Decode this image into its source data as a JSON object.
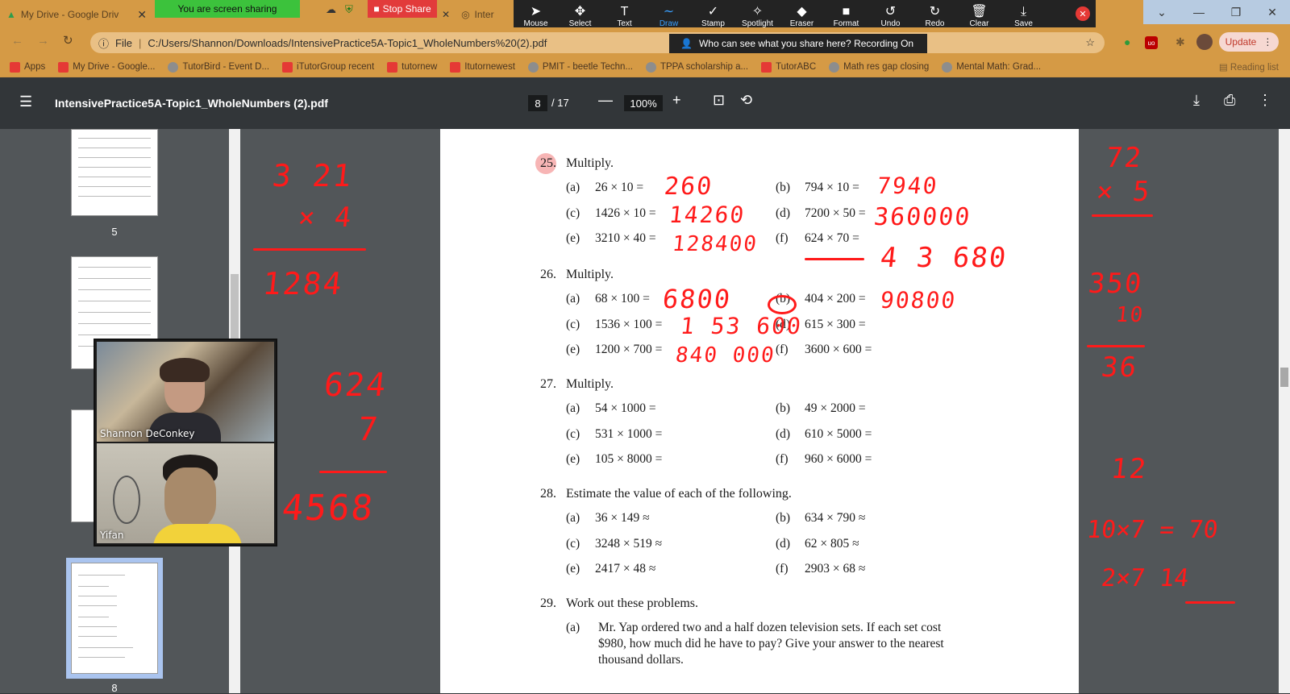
{
  "tabs": [
    {
      "title": "My Drive - Google Driv",
      "icon": "google-drive-icon"
    },
    {
      "title": "",
      "icon": "zoom-icon"
    },
    {
      "title": "Inter",
      "icon": "globe-icon"
    }
  ],
  "share": {
    "status": "You are screen sharing",
    "stop_label": "Stop Share"
  },
  "zoom_toolbar": [
    {
      "label": "Mouse",
      "icon": "pointer-icon",
      "glyph": "➤"
    },
    {
      "label": "Select",
      "icon": "move-icon",
      "glyph": "✥"
    },
    {
      "label": "Text",
      "icon": "text-icon",
      "glyph": "T"
    },
    {
      "label": "Draw",
      "icon": "draw-icon",
      "glyph": "∼"
    },
    {
      "label": "Stamp",
      "icon": "stamp-icon",
      "glyph": "✓"
    },
    {
      "label": "Spotlight",
      "icon": "spotlight-icon",
      "glyph": "✧"
    },
    {
      "label": "Eraser",
      "icon": "eraser-icon",
      "glyph": "◆"
    },
    {
      "label": "Format",
      "icon": "format-icon",
      "glyph": "■"
    },
    {
      "label": "Undo",
      "icon": "undo-icon",
      "glyph": "↺"
    },
    {
      "label": "Redo",
      "icon": "redo-icon",
      "glyph": "↻"
    },
    {
      "label": "Clear",
      "icon": "trash-icon",
      "glyph": "🗑"
    },
    {
      "label": "Save",
      "icon": "save-icon",
      "glyph": "⤓"
    }
  ],
  "recording_notice": "Who can see what you share here? Recording On",
  "address": {
    "scheme_label": "File",
    "url": "C:/Users/Shannon/Downloads/IntensivePractice5A-Topic1_WholeNumbers%20(2).pdf"
  },
  "update_label": "Update",
  "bookmarks": [
    {
      "label": "Apps",
      "icon": "apps-icon"
    },
    {
      "label": "My Drive - Google...",
      "icon": "google-drive-icon"
    },
    {
      "label": "TutorBird - Event D...",
      "icon": "tutorbird-icon"
    },
    {
      "label": "iTutorGroup recent",
      "icon": "bookmark-icon"
    },
    {
      "label": "tutornew",
      "icon": "bookmark-icon"
    },
    {
      "label": "Itutornewest",
      "icon": "bookmark-icon"
    },
    {
      "label": "PMIT - beetle Techn...",
      "icon": "globe-icon"
    },
    {
      "label": "TPPA scholarship a...",
      "icon": "tppa-icon"
    },
    {
      "label": "TutorABC",
      "icon": "bookmark-icon"
    },
    {
      "label": "Math res gap closing",
      "icon": "globe-icon"
    },
    {
      "label": "Mental Math: Grad...",
      "icon": "globe-icon"
    }
  ],
  "reading_list": "Reading list",
  "pdf": {
    "title": "IntensivePractice5A-Topic1_WholeNumbers (2).pdf",
    "page": "8",
    "total": "/ 17",
    "zoom": "100%"
  },
  "thumbnails": [
    {
      "label": "5"
    },
    {
      "label": "8"
    }
  ],
  "participants": [
    {
      "name": "Shannon DeConkey"
    },
    {
      "name": "Yifan"
    }
  ],
  "questions": [
    {
      "num": "25.",
      "title": "Multiply.",
      "items": [
        {
          "label": "(a)",
          "expr": "26 × 10 ="
        },
        {
          "label": "(b)",
          "expr": "794 × 10 ="
        },
        {
          "label": "(c)",
          "expr": "1426 × 10 ="
        },
        {
          "label": "(d)",
          "expr": "7200 × 50 ="
        },
        {
          "label": "(e)",
          "expr": "3210 × 40 ="
        },
        {
          "label": "(f)",
          "expr": "624 × 70 ="
        }
      ]
    },
    {
      "num": "26.",
      "title": "Multiply.",
      "items": [
        {
          "label": "(a)",
          "expr": "68 × 100 ="
        },
        {
          "label": "(b)",
          "expr": "404 × 200 ="
        },
        {
          "label": "(c)",
          "expr": "1536 × 100 ="
        },
        {
          "label": "(d)",
          "expr": "615 × 300 ="
        },
        {
          "label": "(e)",
          "expr": "1200 × 700 ="
        },
        {
          "label": "(f)",
          "expr": "3600 × 600 ="
        }
      ]
    },
    {
      "num": "27.",
      "title": "Multiply.",
      "items": [
        {
          "label": "(a)",
          "expr": "54 × 1000 ="
        },
        {
          "label": "(b)",
          "expr": "49 × 2000 ="
        },
        {
          "label": "(c)",
          "expr": "531 × 1000 ="
        },
        {
          "label": "(d)",
          "expr": "610 × 5000 ="
        },
        {
          "label": "(e)",
          "expr": "105 × 8000 ="
        },
        {
          "label": "(f)",
          "expr": "960 × 6000 ="
        }
      ]
    },
    {
      "num": "28.",
      "title": "Estimate the value of each of the following.",
      "items": [
        {
          "label": "(a)",
          "expr": "36 × 149 ≈"
        },
        {
          "label": "(b)",
          "expr": "634 × 790 ≈"
        },
        {
          "label": "(c)",
          "expr": "3248 × 519 ≈"
        },
        {
          "label": "(d)",
          "expr": "62 × 805 ≈"
        },
        {
          "label": "(e)",
          "expr": "2417 × 48 ≈"
        },
        {
          "label": "(f)",
          "expr": "2903 × 68 ≈"
        }
      ]
    },
    {
      "num": "29.",
      "title": "Work out these problems.",
      "items": [
        {
          "label": "(a)",
          "lines": [
            "Mr. Yap ordered two and a half dozen television sets. If each set cost",
            "$980, how much did he have to pay? Give your answer to the nearest",
            "thousand dollars."
          ]
        }
      ]
    }
  ],
  "handwriting": {
    "left_margin": [
      "3 21",
      "× 4",
      "1284",
      "624",
      "7",
      "4568"
    ],
    "answers": [
      "260",
      "7940",
      "14260",
      "360000",
      "128400",
      "4 3 680",
      "6800",
      "90800",
      "1 53 600",
      "840 000"
    ],
    "right_margin": [
      "72",
      "× 5",
      "350",
      "10",
      "36",
      "12",
      "10×7 = 70",
      "2×7  14"
    ]
  },
  "colors": {
    "annotation": "#ff1a1a",
    "tab_strip": "#d59a45",
    "pdf_bg": "#525659",
    "toolbar": "#323639"
  }
}
